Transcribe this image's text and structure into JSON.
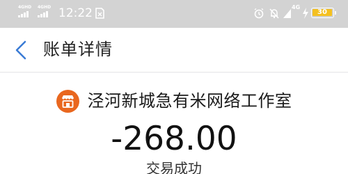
{
  "status_bar": {
    "signal_1_label": "4GHD",
    "signal_2_label": "4GHD",
    "time": "12:22",
    "network_label": "4G",
    "battery_level": "30"
  },
  "nav": {
    "title": "账单详情"
  },
  "bill": {
    "merchant_name": "泾河新城急有米网络工作室",
    "amount": "-268.00",
    "status": "交易成功"
  },
  "colors": {
    "merchant_icon_bg": "#e9671f",
    "back_icon": "#3a7bd5",
    "battery_fill": "#f4c020",
    "status_bar_bg": "#d3d3d3"
  }
}
